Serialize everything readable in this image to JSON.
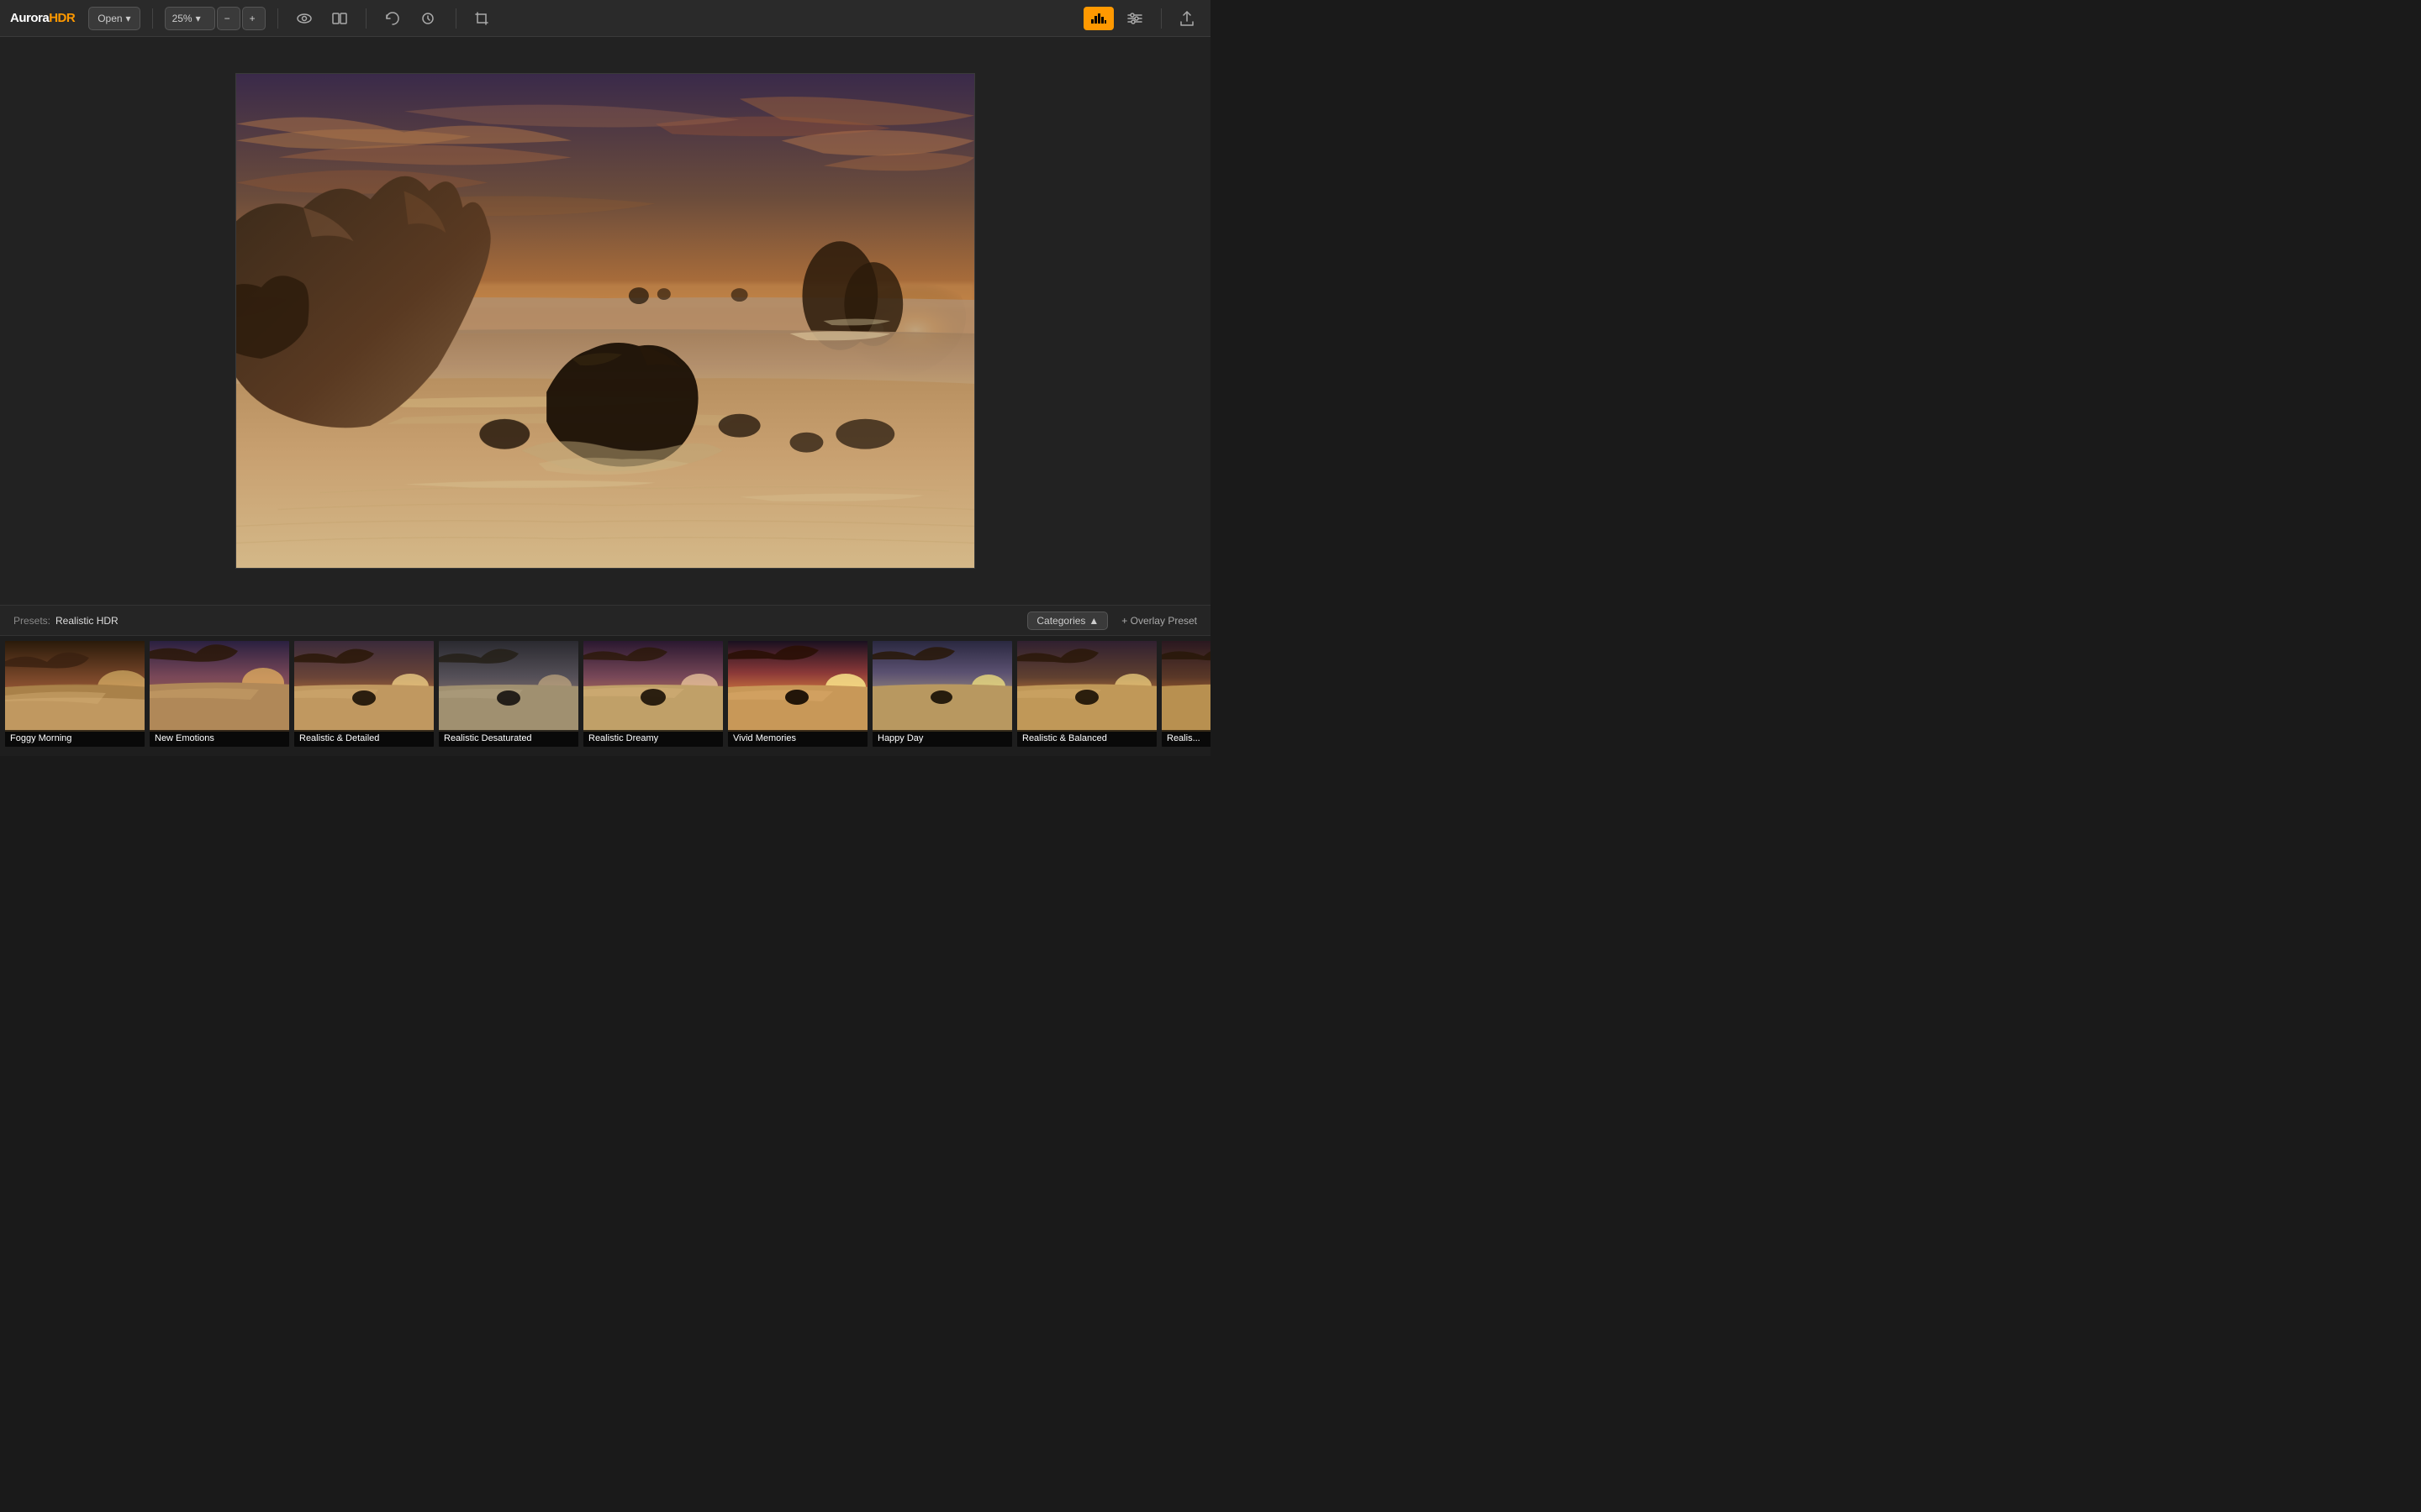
{
  "app": {
    "name_prefix": "Aurora",
    "name_suffix": "HDR"
  },
  "toolbar": {
    "open_label": "Open",
    "open_chevron": "▾",
    "zoom_value": "25%",
    "zoom_chevron": "▾",
    "zoom_out": "−",
    "zoom_in": "+",
    "eye_icon": "👁",
    "compare_icon": "⊡",
    "undo_icon": "↩",
    "history_icon": "🕐",
    "history_chevron": "▾",
    "crop_icon": "⊞",
    "histogram_icon": "▦",
    "sliders_icon": "⊟",
    "export_icon": "↑"
  },
  "presets": {
    "label": "Presets:",
    "active_category": "Realistic HDR",
    "categories_btn": "Categories",
    "categories_chevron": "▲",
    "overlay_preset_btn": "+ Overlay Preset",
    "items": [
      {
        "id": "foggy-morning",
        "label": "Foggy Morning"
      },
      {
        "id": "new-emotions",
        "label": "New Emotions"
      },
      {
        "id": "realistic-detailed",
        "label": "Realistic & Detailed"
      },
      {
        "id": "realistic-desaturated",
        "label": "Realistic Desaturated"
      },
      {
        "id": "realistic-dreamy",
        "label": "Realistic Dreamy"
      },
      {
        "id": "vivid-memories",
        "label": "Vivid Memories"
      },
      {
        "id": "happy-day",
        "label": "Happy Day"
      },
      {
        "id": "realistic-balanced",
        "label": "Realistic & Balanced"
      },
      {
        "id": "realis",
        "label": "Realis..."
      }
    ]
  },
  "colors": {
    "accent": "#f90",
    "toolbar_bg": "#2a2a2a",
    "panel_bg": "#1e1e1e",
    "surface": "#3a3a3a"
  }
}
